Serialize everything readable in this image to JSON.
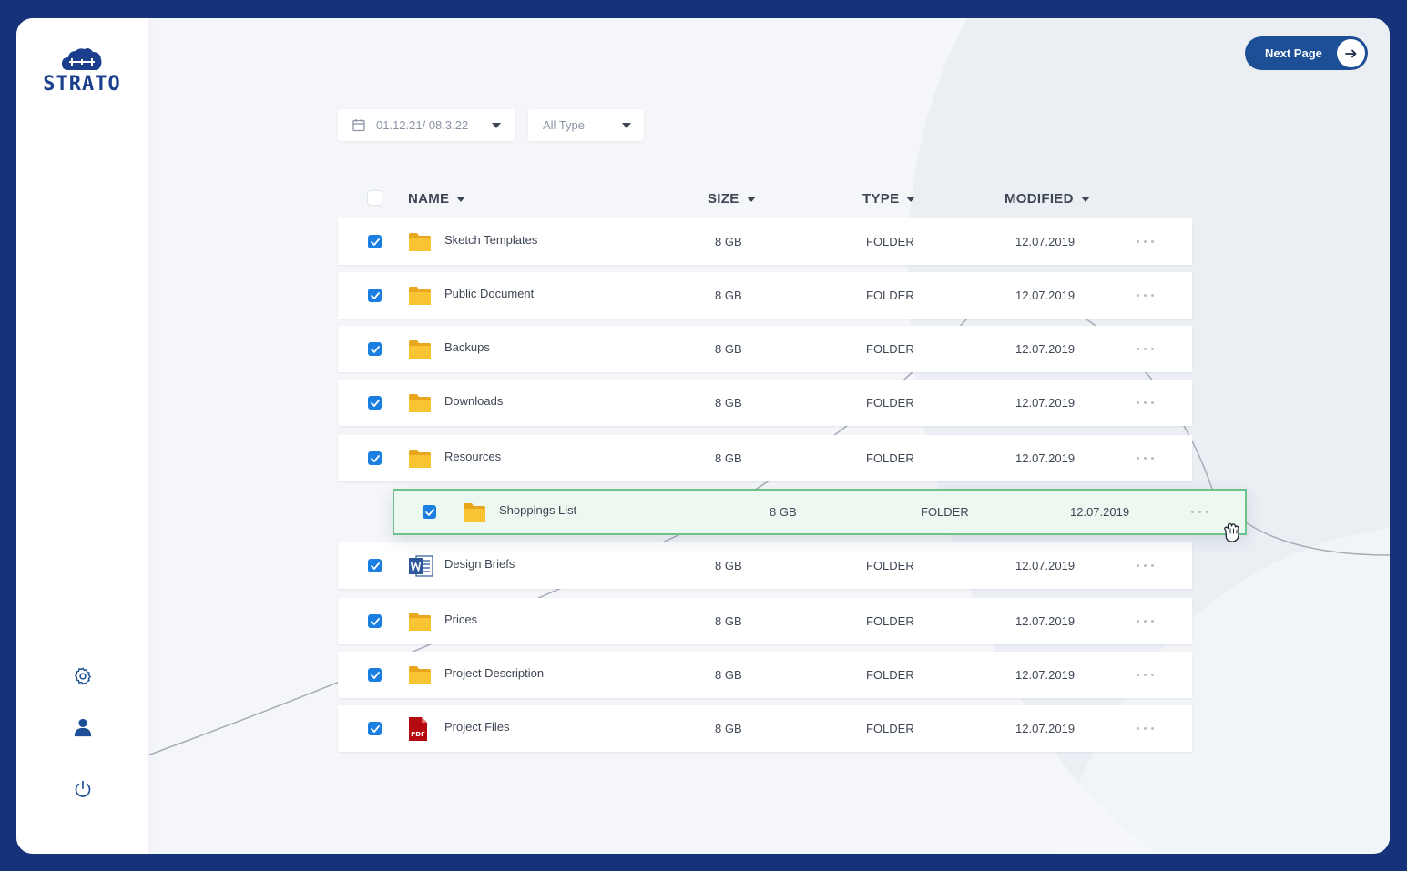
{
  "brand": {
    "name": "STRATO"
  },
  "header_actions": {
    "next_page_label": "Next Page"
  },
  "filters": {
    "date_range": "01.12.21/ 08.3.22",
    "type": "All Type"
  },
  "columns": {
    "name": "NAME",
    "size": "SIZE",
    "type": "TYPE",
    "modified": "MODIFIED"
  },
  "files": [
    {
      "name": "Sketch Templates",
      "size": "8 GB",
      "type": "FOLDER",
      "modified": "12.07.2019",
      "icon": "folder-icon",
      "checked": true
    },
    {
      "name": "Public Document",
      "size": "8 GB",
      "type": "FOLDER",
      "modified": "12.07.2019",
      "icon": "folder-icon",
      "checked": true
    },
    {
      "name": "Backups",
      "size": "8 GB",
      "type": "FOLDER",
      "modified": "12.07.2019",
      "icon": "folder-icon",
      "checked": true
    },
    {
      "name": "Downloads",
      "size": "8 GB",
      "type": "FOLDER",
      "modified": "12.07.2019",
      "icon": "folder-icon",
      "checked": true
    },
    {
      "name": "Resources",
      "size": "8 GB",
      "type": "FOLDER",
      "modified": "12.07.2019",
      "icon": "folder-icon",
      "checked": true
    },
    {
      "name": "Shoppings List",
      "size": "8 GB",
      "type": "FOLDER",
      "modified": "12.07.2019",
      "icon": "folder-icon",
      "checked": true,
      "dragging": true
    },
    {
      "name": "Design Briefs",
      "size": "8 GB",
      "type": "FOLDER",
      "modified": "12.07.2019",
      "icon": "word-doc-icon",
      "checked": true
    },
    {
      "name": "Prices",
      "size": "8 GB",
      "type": "FOLDER",
      "modified": "12.07.2019",
      "icon": "folder-icon",
      "checked": true
    },
    {
      "name": "Project Description",
      "size": "8 GB",
      "type": "FOLDER",
      "modified": "12.07.2019",
      "icon": "folder-icon",
      "checked": true
    },
    {
      "name": "Project Files",
      "size": "8 GB",
      "type": "FOLDER",
      "modified": "12.07.2019",
      "icon": "pdf-icon",
      "icon_text": "PDF",
      "checked": true
    }
  ],
  "colors": {
    "background": "#16337a",
    "accent": "#1c4f96",
    "checkbox": "#1a7fe0",
    "folder": "#f8c433",
    "drag_row_bg": "#ecf8f0",
    "drag_row_border": "#6cc38b"
  },
  "sidebar_icons": [
    "gear-icon",
    "user-icon",
    "power-icon"
  ],
  "cursor": "grab-hand-icon"
}
